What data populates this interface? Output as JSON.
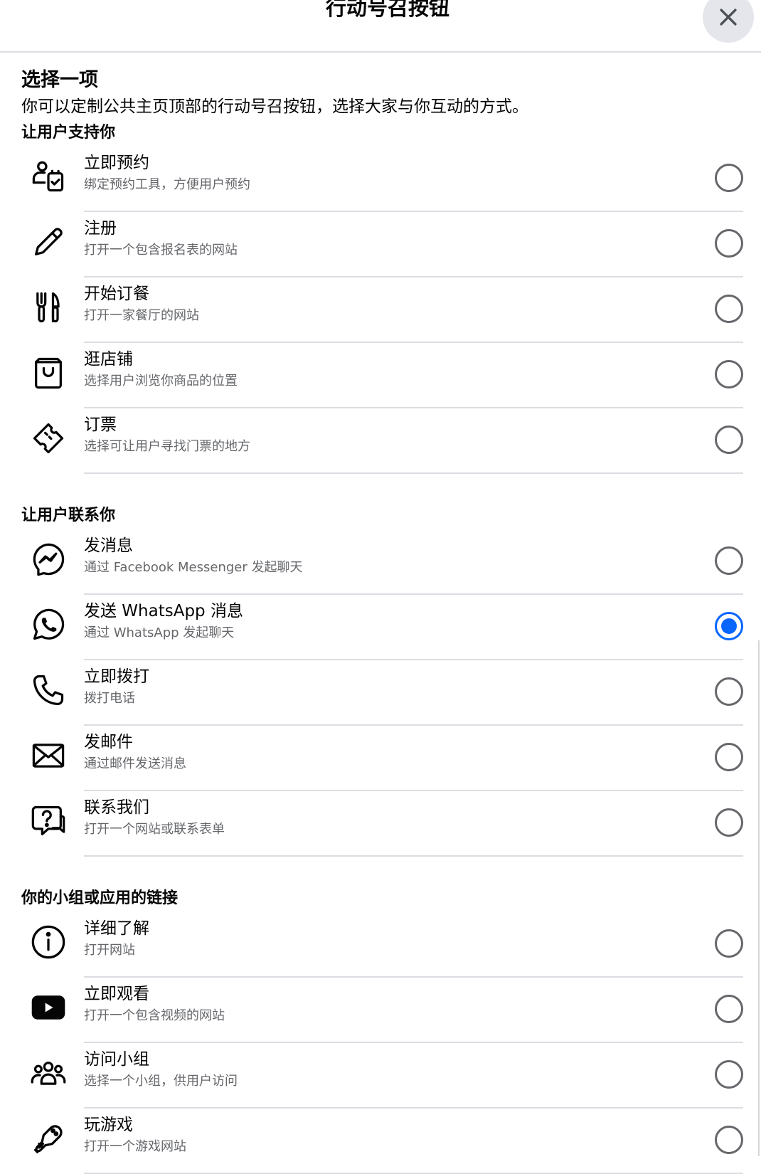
{
  "header": {
    "title": "行动号召按钮"
  },
  "intro": {
    "title": "选择一项",
    "description": "你可以定制公共主页顶部的行动号召按钮，选择大家与你互动的方式。"
  },
  "sections": [
    {
      "title": "让用户支持你",
      "items": [
        {
          "icon": "appointment-icon",
          "title": "立即预约",
          "subtitle": "绑定预约工具，方便用户预约",
          "selected": false
        },
        {
          "icon": "pencil-icon",
          "title": "注册",
          "subtitle": "打开一个包含报名表的网站",
          "selected": false
        },
        {
          "icon": "utensils-icon",
          "title": "开始订餐",
          "subtitle": "打开一家餐厅的网站",
          "selected": false
        },
        {
          "icon": "shopping-bag-icon",
          "title": "逛店铺",
          "subtitle": "选择用户浏览你商品的位置",
          "selected": false
        },
        {
          "icon": "ticket-icon",
          "title": "订票",
          "subtitle": "选择可让用户寻找门票的地方",
          "selected": false
        }
      ]
    },
    {
      "title": "让用户联系你",
      "items": [
        {
          "icon": "messenger-icon",
          "title": "发消息",
          "subtitle": "通过 Facebook Messenger 发起聊天",
          "selected": false
        },
        {
          "icon": "whatsapp-icon",
          "title": "发送 WhatsApp 消息",
          "subtitle": "通过 WhatsApp 发起聊天",
          "selected": true
        },
        {
          "icon": "phone-icon",
          "title": "立即拨打",
          "subtitle": "拨打电话",
          "selected": false
        },
        {
          "icon": "envelope-icon",
          "title": "发邮件",
          "subtitle": "通过邮件发送消息",
          "selected": false
        },
        {
          "icon": "help-chat-icon",
          "title": "联系我们",
          "subtitle": "打开一个网站或联系表单",
          "selected": false
        }
      ]
    },
    {
      "title": "你的小组或应用的链接",
      "items": [
        {
          "icon": "info-icon",
          "title": "详细了解",
          "subtitle": "打开网站",
          "selected": false
        },
        {
          "icon": "youtube-play-icon",
          "title": "立即观看",
          "subtitle": "打开一个包含视频的网站",
          "selected": false
        },
        {
          "icon": "group-icon",
          "title": "访问小组",
          "subtitle": "选择一个小组，供用户访问",
          "selected": false
        },
        {
          "icon": "game-controller-icon",
          "title": "玩游戏",
          "subtitle": "打开一个游戏网站",
          "selected": false
        }
      ]
    }
  ],
  "colors": {
    "accent": "#0866ff",
    "text": "#050505",
    "secondary_text": "#65676b",
    "divider": "#dadde1"
  }
}
